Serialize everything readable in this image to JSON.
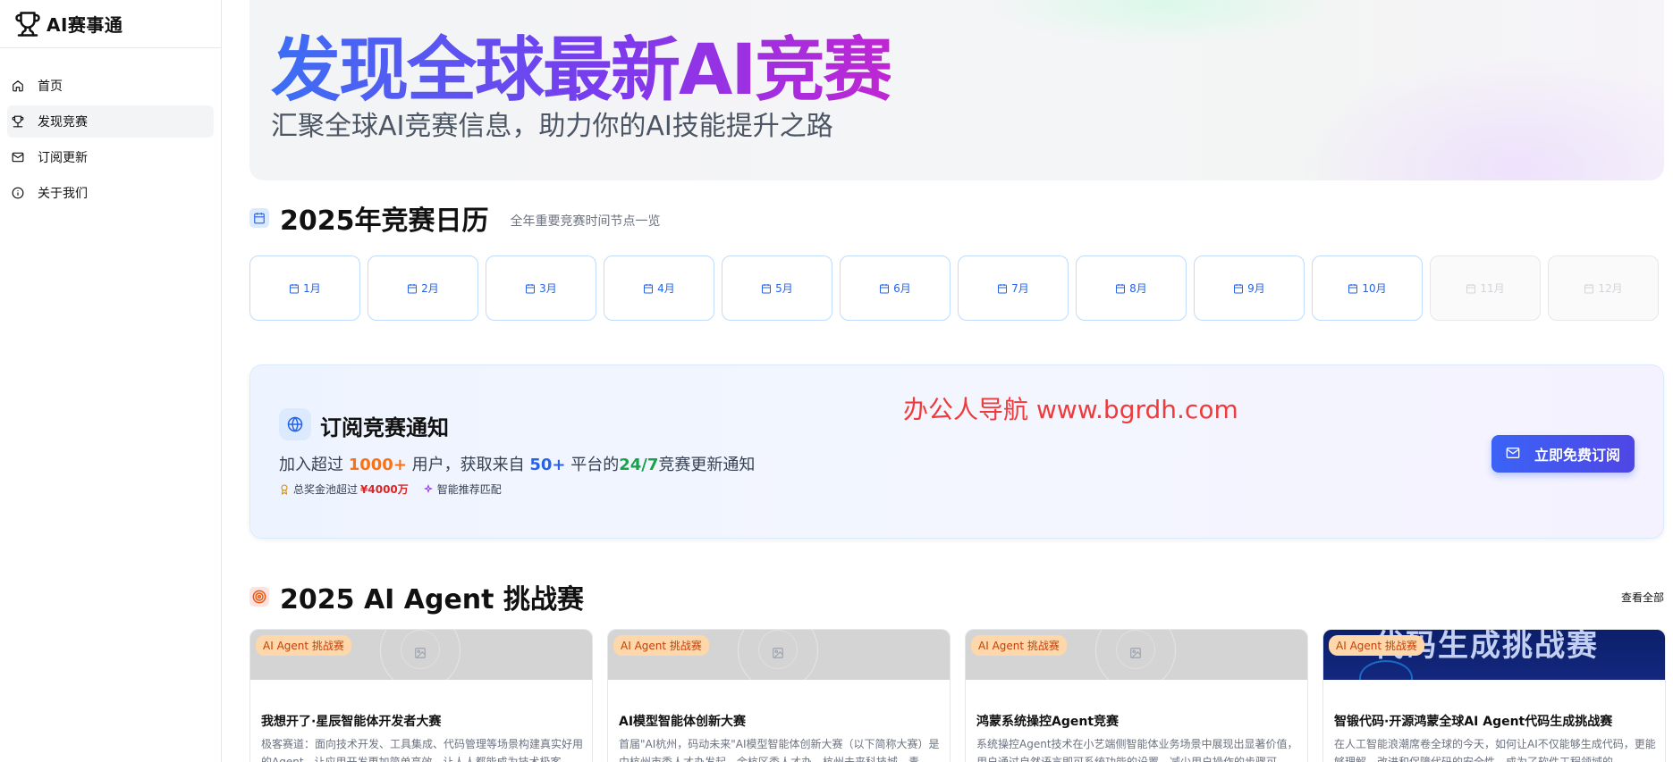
{
  "brand": {
    "title": "AI赛事通",
    "icon": "trophy-icon"
  },
  "nav": [
    {
      "label": "首页",
      "icon": "home-icon",
      "active": false
    },
    {
      "label": "发现竞赛",
      "icon": "trophy-icon",
      "active": true
    },
    {
      "label": "订阅更新",
      "icon": "mail-icon",
      "active": false
    },
    {
      "label": "关于我们",
      "icon": "info-icon",
      "active": false
    }
  ],
  "hero": {
    "title": "发现全球最新AI竞赛",
    "subtitle": "汇聚全球AI竞赛信息，助力你的AI技能提升之路"
  },
  "calendar": {
    "title": "2025年竞赛日历",
    "description": "全年重要竞赛时间节点一览",
    "months": [
      {
        "label": "1月",
        "enabled": true
      },
      {
        "label": "2月",
        "enabled": true
      },
      {
        "label": "3月",
        "enabled": true
      },
      {
        "label": "4月",
        "enabled": true
      },
      {
        "label": "5月",
        "enabled": true
      },
      {
        "label": "6月",
        "enabled": true
      },
      {
        "label": "7月",
        "enabled": true
      },
      {
        "label": "8月",
        "enabled": true
      },
      {
        "label": "9月",
        "enabled": true
      },
      {
        "label": "10月",
        "enabled": true
      },
      {
        "label": "11月",
        "enabled": false
      },
      {
        "label": "12月",
        "enabled": false
      }
    ]
  },
  "subscribe": {
    "title": "订阅竞赛通知",
    "line_prefix": "加入超过 ",
    "users": "1000+",
    "line_mid1": " 用户，获取来自 ",
    "platforms": "50+",
    "line_mid2": " 平台的",
    "always": "24/7",
    "line_suffix": "竞赛更新通知",
    "prize_label": "总奖金池超过",
    "prize_value": "¥4000万",
    "match_label": "智能推荐匹配",
    "button": "立即免费订阅",
    "watermark": "办公人导航  www.bgrdh.com"
  },
  "agent_section": {
    "title": "2025 AI Agent 挑战赛",
    "view_all": "查看全部",
    "cards": [
      {
        "badge": "AI Agent 挑战赛",
        "title": "我想开了·星辰智能体开发者大赛",
        "desc": "极客赛道：面向技术开发、工具集成、代码管理等场景构建真实好用的Agent，让应用开发更加简单高效，让人人都能成为技术极客。",
        "image": "placeholder"
      },
      {
        "badge": "AI Agent 挑战赛",
        "title": "AI模型智能体创新大赛",
        "desc": "首届\"AI杭州，码动未来\"AI模型智能体创新大赛（以下简称大赛）是由杭州市委人才办发起，余杭区委人才办、杭州未来科技城、青",
        "image": "placeholder"
      },
      {
        "badge": "AI Agent 挑战赛",
        "title": "鸿蒙系统操控Agent竞赛",
        "desc": "系统操控Agent技术在小艺端侧智能体业务场景中展现出显著价值，用户通过自然语言即可系统功能的设置，减少用户操作的步骤可",
        "image": "placeholder"
      },
      {
        "badge": "AI Agent 挑战赛",
        "title": "智锻代码·开源鸿蒙全球AI Agent代码生成挑战赛",
        "desc": "在人工智能浪潮席卷全球的今天，如何让AI不仅能够生成代码，更能够理解、改进和保障代码的安全性，成为了软件工程领域的",
        "image": "dark",
        "image_text": "代码生成挑战赛"
      }
    ]
  },
  "colors": {
    "accent": "#2563eb",
    "gradient_start": "#3b6ff5",
    "gradient_end": "#c026d3",
    "badge_bg": "#fed7aa",
    "badge_text": "#c2410c"
  }
}
